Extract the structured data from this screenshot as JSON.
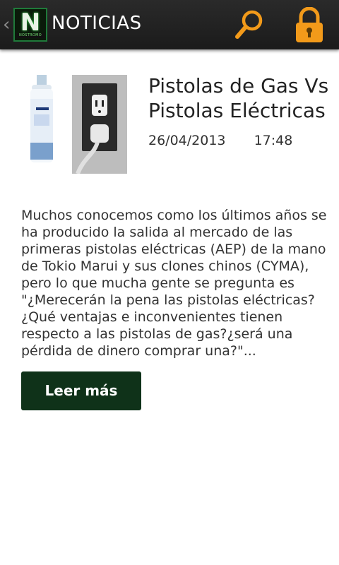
{
  "actionbar": {
    "title": "NOTICIAS",
    "logo_letter": "N",
    "logo_tag": "NOSTROMO",
    "up_icon": "chevron-left-icon",
    "search_icon": "search-icon",
    "lock_icon": "lock-icon",
    "accent_color": "#f29a1a"
  },
  "article": {
    "title": "Pistolas de Gas Vs Pistolas Eléctricas",
    "date": "26/04/2013",
    "time": "17:48",
    "excerpt": "Muchos conocemos como los últimos años se ha producido la salida al mercado de las primeras pistolas eléctricas (AEP) de la mano de Tokio Marui y sus clones chinos (CYMA), pero lo que mucha gente se pregunta es \"¿Merecerán la pena las pistolas eléctricas?¿Qué ventajas e inconvenientes tienen respecto a las pistolas de gas?¿será una pérdida de dinero comprar una?\"...",
    "read_more_label": "Leer más",
    "thumbnail_subjects": [
      "gas-canister",
      "power-outlet-with-plug"
    ],
    "button_color": "#0f3219"
  }
}
